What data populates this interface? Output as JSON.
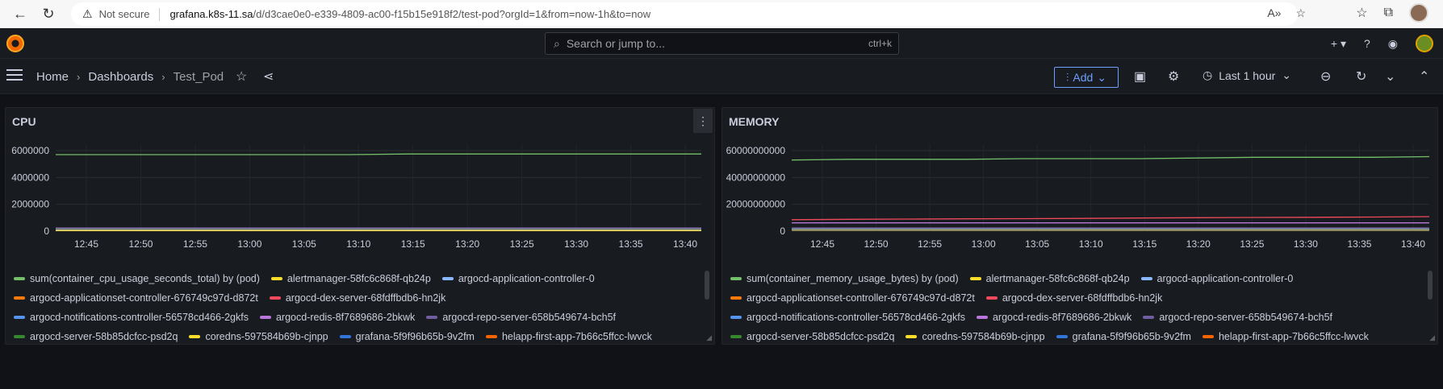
{
  "browser": {
    "not_secure": "Not secure",
    "url_host": "grafana.k8s-11.sa",
    "url_path": "/d/d3cae0e0-e339-4809-ac00-f15b15e918f2/test-pod?orgId=1&from=now-1h&to=now"
  },
  "top": {
    "search_placeholder": "Search or jump to...",
    "search_shortcut": "ctrl+k"
  },
  "nav": {
    "crumbs": [
      "Home",
      "Dashboards",
      "Test_Pod"
    ],
    "add_label": "Add",
    "time_range": "Last 1 hour"
  },
  "panels": [
    {
      "title": "CPU",
      "y_ticks": [
        "6000000",
        "4000000",
        "2000000",
        "0"
      ],
      "x_ticks": [
        "12:45",
        "12:50",
        "12:55",
        "13:00",
        "13:05",
        "13:10",
        "13:15",
        "13:20",
        "13:25",
        "13:30",
        "13:35",
        "13:40"
      ]
    },
    {
      "title": "MEMORY",
      "y_ticks": [
        "60000000000",
        "40000000000",
        "20000000000",
        "0"
      ],
      "x_ticks": [
        "12:45",
        "12:50",
        "12:55",
        "13:00",
        "13:05",
        "13:10",
        "13:15",
        "13:20",
        "13:25",
        "13:30",
        "13:35",
        "13:40"
      ]
    }
  ],
  "legend": [
    [
      {
        "label": "sum(container_cpu_usage_seconds_total) by (pod)",
        "color": "#73bf69"
      },
      {
        "label": "alertmanager-58fc6c868f-qb24p",
        "color": "#fade2a"
      },
      {
        "label": "argocd-application-controller-0",
        "color": "#8ab8ff"
      }
    ],
    [
      {
        "label": "argocd-applicationset-controller-676749c97d-d872t",
        "color": "#ff780a"
      },
      {
        "label": "argocd-dex-server-68fdffbdb6-hn2jk",
        "color": "#f2495c"
      }
    ],
    [
      {
        "label": "argocd-notifications-controller-56578cd466-2gkfs",
        "color": "#5794f2"
      },
      {
        "label": "argocd-redis-8f7689686-2bkwk",
        "color": "#b877d9"
      },
      {
        "label": "argocd-repo-server-658b549674-bch5f",
        "color": "#705da0"
      }
    ],
    [
      {
        "label": "argocd-server-58b85dcfcc-psd2q",
        "color": "#37872d"
      },
      {
        "label": "coredns-597584b69b-cjnpp",
        "color": "#fade2a"
      },
      {
        "label": "grafana-5f9f96b65b-9v2fm",
        "color": "#3274d9"
      },
      {
        "label": "helapp-first-app-7b66c5ffcc-lwvck",
        "color": "#fa6400"
      }
    ]
  ],
  "legend_mem_first": "sum(container_memory_usage_bytes) by (pod)",
  "chart_data": [
    {
      "type": "line",
      "title": "CPU",
      "x": [
        "12:45",
        "12:50",
        "12:55",
        "13:00",
        "13:05",
        "13:10",
        "13:15",
        "13:20",
        "13:25",
        "13:30",
        "13:35",
        "13:40"
      ],
      "ylim": [
        0,
        7000000
      ],
      "series": [
        {
          "name": "sum(container_cpu_usage_seconds_total) by (pod)",
          "color": "#73bf69",
          "values": [
            5700000,
            5700000,
            5700000,
            5700000,
            5700000,
            5700000,
            5750000,
            5750000,
            5750000,
            5750000,
            5750000,
            5750000
          ]
        },
        {
          "name": "alertmanager-58fc6c868f-qb24p",
          "color": "#fade2a",
          "values": [
            40000,
            40000,
            40000,
            40000,
            40000,
            40000,
            40000,
            40000,
            40000,
            40000,
            40000,
            40000
          ]
        },
        {
          "name": "argocd-application-controller-0",
          "color": "#8ab8ff",
          "values": [
            90000,
            90000,
            90000,
            90000,
            90000,
            90000,
            90000,
            90000,
            90000,
            90000,
            90000,
            90000
          ]
        }
      ]
    },
    {
      "type": "line",
      "title": "MEMORY",
      "x": [
        "12:45",
        "12:50",
        "12:55",
        "13:00",
        "13:05",
        "13:10",
        "13:15",
        "13:20",
        "13:25",
        "13:30",
        "13:35",
        "13:40"
      ],
      "ylim": [
        0,
        66000000000
      ],
      "series": [
        {
          "name": "sum(container_memory_usage_bytes) by (pod)",
          "color": "#73bf69",
          "values": [
            53000000000,
            53500000000,
            53500000000,
            53500000000,
            54000000000,
            54000000000,
            54000000000,
            54500000000,
            55000000000,
            55000000000,
            55000000000,
            55500000000
          ]
        },
        {
          "name": "argocd-dex-server-68fdffbdb6-hn2jk",
          "color": "#f2495c",
          "values": [
            8500000000,
            8800000000,
            9000000000,
            9200000000,
            9300000000,
            9500000000,
            9800000000,
            10000000000,
            10200000000,
            10300000000,
            10500000000,
            10800000000
          ]
        },
        {
          "name": "argocd-redis-8f7689686-2bkwk",
          "color": "#b877d9",
          "values": [
            6200000000,
            6200000000,
            6200000000,
            6200000000,
            6200000000,
            6200000000,
            6200000000,
            6200000000,
            6200000000,
            6200000000,
            6200000000,
            6200000000
          ]
        },
        {
          "name": "argocd-notifications-controller-56578cd466-2gkfs",
          "color": "#5794f2",
          "values": [
            1500000000,
            1500000000,
            1500000000,
            1500000000,
            1500000000,
            1500000000,
            1500000000,
            1500000000,
            1500000000,
            1500000000,
            1500000000,
            1500000000
          ]
        }
      ]
    }
  ]
}
